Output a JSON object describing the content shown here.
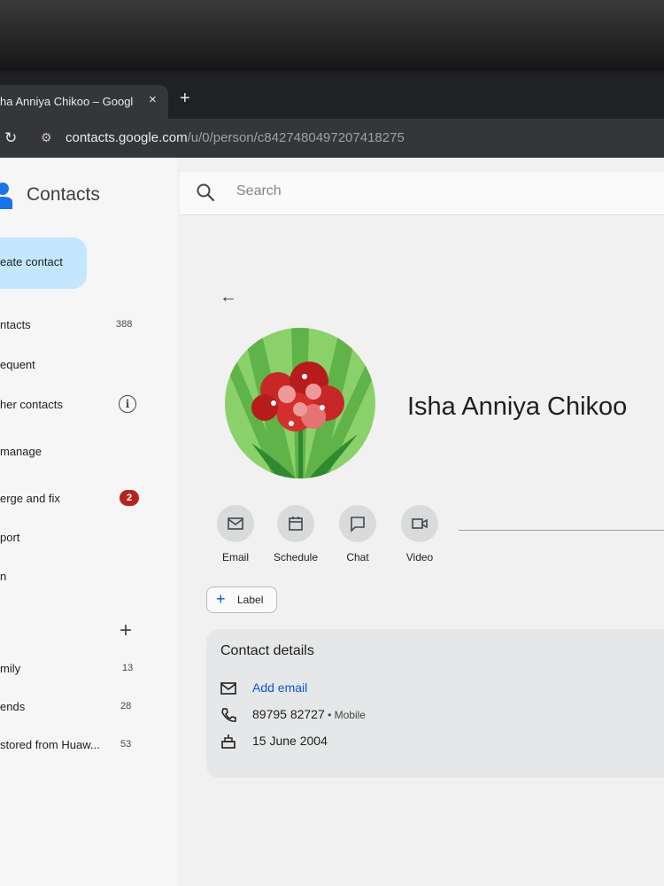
{
  "browser": {
    "tab_title": "ha Anniya Chikoo – Google C",
    "tab_close": "×",
    "new_tab": "+",
    "url_domain": "contacts.google.com",
    "url_path": "/u/0/person/c8427480497207418275"
  },
  "app": {
    "name": "Contacts"
  },
  "search": {
    "placeholder": "Search"
  },
  "sidebar": {
    "create_label": "eate contact",
    "items": [
      {
        "label": "ntacts",
        "count": "388"
      },
      {
        "label": "equent"
      },
      {
        "label": "her contacts"
      },
      {
        "label": "manage"
      },
      {
        "label": "erge and fix",
        "badge": "2"
      },
      {
        "label": "port"
      },
      {
        "label": "n"
      }
    ],
    "labels": [
      {
        "label": "mily",
        "count": "13"
      },
      {
        "label": "ends",
        "count": "28"
      },
      {
        "label": "stored from Huaw...",
        "count": "53"
      }
    ]
  },
  "contact": {
    "name": "Isha Anniya Chikoo",
    "actions": [
      "Email",
      "Schedule",
      "Chat",
      "Video"
    ],
    "label_button": "Label",
    "details": {
      "title": "Contact details",
      "add_email": "Add email",
      "phone": "89795 82727",
      "phone_type": " • Mobile",
      "birthday": "15 June 2004"
    }
  },
  "colors": {
    "accent": "#0b57d0",
    "create_bg": "#c2e7ff",
    "badge": "#b3261e"
  }
}
